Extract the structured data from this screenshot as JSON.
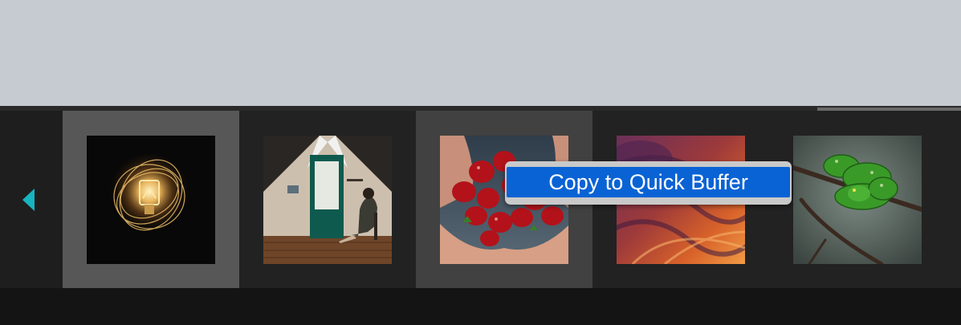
{
  "colors": {
    "top_pane": "#c6cad1",
    "filmstrip_bg": "#222222",
    "selected_cell": "#575757",
    "hover_cell": "#414141",
    "nav_arrow": "#18b3c0",
    "menu_highlight": "#0a63d4"
  },
  "filmstrip": {
    "nav_left_icon": "triangle-left-icon",
    "thumbnails": [
      {
        "subject": "light-bulb",
        "state": "selected"
      },
      {
        "subject": "woman-in-attic-room",
        "state": "normal"
      },
      {
        "subject": "strawberries-in-hands",
        "state": "hover"
      },
      {
        "subject": "red-canyon-waves",
        "state": "normal"
      },
      {
        "subject": "green-tree-python",
        "state": "normal"
      }
    ]
  },
  "context_menu": {
    "items": [
      "Copy to Quick Buffer"
    ],
    "highlighted_index": 0
  }
}
